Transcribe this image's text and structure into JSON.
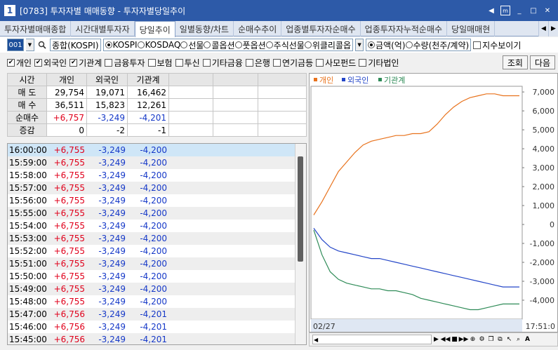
{
  "window": {
    "num": "1",
    "title": "[0783] 투자자별 매매동향 - 투자자별당일추이"
  },
  "tabs": [
    {
      "label": "투자자별매매종합",
      "active": false
    },
    {
      "label": "시간대별투자자",
      "active": false
    },
    {
      "label": "당일추이",
      "active": true
    },
    {
      "label": "일별동향/차트",
      "active": false
    },
    {
      "label": "순매수추이",
      "active": false
    },
    {
      "label": "업종별투자자순매수",
      "active": false
    },
    {
      "label": "업종투자자누적순매수",
      "active": false
    },
    {
      "label": "당일매매현",
      "active": false
    }
  ],
  "toolbar": {
    "code": "001",
    "market_name": "종합(KOSPI)",
    "markets": [
      "KOSPI",
      "KOSDAQ",
      "선물",
      "콜옵션",
      "풋옵션",
      "주식선물",
      "위클리콜옵"
    ],
    "market_selected": "KOSPI",
    "units": [
      "금액(억)",
      "수량(천주/계약)"
    ],
    "unit_selected": "금액(억)",
    "index_view_label": "지수보이기"
  },
  "filters": {
    "items": [
      {
        "label": "개인",
        "checked": true
      },
      {
        "label": "외국인",
        "checked": true
      },
      {
        "label": "기관계",
        "checked": true
      },
      {
        "label": "금융투자",
        "checked": false
      },
      {
        "label": "보험",
        "checked": false
      },
      {
        "label": "투신",
        "checked": false
      },
      {
        "label": "기타금융",
        "checked": false
      },
      {
        "label": "은행",
        "checked": false
      },
      {
        "label": "연기금등",
        "checked": false
      },
      {
        "label": "사모펀드",
        "checked": false
      },
      {
        "label": "기타법인",
        "checked": false
      }
    ],
    "query_label": "조회",
    "next_label": "다음"
  },
  "summary": {
    "headers": [
      "시간",
      "개인",
      "외국인",
      "기관계"
    ],
    "rows": [
      {
        "label": "매 도",
        "values": [
          "29,754",
          "19,071",
          "16,462"
        ]
      },
      {
        "label": "매 수",
        "values": [
          "36,511",
          "15,823",
          "12,261"
        ]
      },
      {
        "label": "순매수",
        "values": [
          "+6,757",
          "-3,249",
          "-4,201"
        ]
      },
      {
        "label": "증감",
        "values": [
          "0",
          "-2",
          "-1"
        ]
      }
    ]
  },
  "timeline": [
    {
      "time": "16:00:00",
      "ind": "+6,755",
      "for": "-3,249",
      "inst": "-4,200"
    },
    {
      "time": "15:59:00",
      "ind": "+6,755",
      "for": "-3,249",
      "inst": "-4,200"
    },
    {
      "time": "15:58:00",
      "ind": "+6,755",
      "for": "-3,249",
      "inst": "-4,200"
    },
    {
      "time": "15:57:00",
      "ind": "+6,755",
      "for": "-3,249",
      "inst": "-4,200"
    },
    {
      "time": "15:56:00",
      "ind": "+6,755",
      "for": "-3,249",
      "inst": "-4,200"
    },
    {
      "time": "15:55:00",
      "ind": "+6,755",
      "for": "-3,249",
      "inst": "-4,200"
    },
    {
      "time": "15:54:00",
      "ind": "+6,755",
      "for": "-3,249",
      "inst": "-4,200"
    },
    {
      "time": "15:53:00",
      "ind": "+6,755",
      "for": "-3,249",
      "inst": "-4,200"
    },
    {
      "time": "15:52:00",
      "ind": "+6,755",
      "for": "-3,249",
      "inst": "-4,200"
    },
    {
      "time": "15:51:00",
      "ind": "+6,755",
      "for": "-3,249",
      "inst": "-4,200"
    },
    {
      "time": "15:50:00",
      "ind": "+6,755",
      "for": "-3,249",
      "inst": "-4,200"
    },
    {
      "time": "15:49:00",
      "ind": "+6,755",
      "for": "-3,249",
      "inst": "-4,200"
    },
    {
      "time": "15:48:00",
      "ind": "+6,755",
      "for": "-3,249",
      "inst": "-4,200"
    },
    {
      "time": "15:47:00",
      "ind": "+6,756",
      "for": "-3,249",
      "inst": "-4,201"
    },
    {
      "time": "15:46:00",
      "ind": "+6,756",
      "for": "-3,249",
      "inst": "-4,201"
    },
    {
      "time": "15:45:00",
      "ind": "+6,756",
      "for": "-3,249",
      "inst": "-4,201"
    }
  ],
  "chart_data": {
    "type": "line",
    "legend": [
      "개인",
      "외국인",
      "기관계"
    ],
    "colors": {
      "개인": "#e8721c",
      "외국인": "#2446c8",
      "기관계": "#2e8b57"
    },
    "ylim": [
      -5000,
      7300
    ],
    "yticks": [
      7000,
      6000,
      5000,
      4000,
      3000,
      2000,
      1000,
      0,
      -1000,
      -2000,
      -3000,
      -4000
    ],
    "ytick_labels": [
      "7,000",
      "6,000",
      "5,000",
      "4,000",
      "3,000",
      "2,000",
      "1,000",
      "0",
      "-1,000",
      "-2,000",
      "-3,000",
      "-4,000"
    ],
    "x_label_left": "02/27",
    "x_label_right": "17:51:0",
    "series": [
      {
        "name": "개인",
        "values": [
          500,
          1200,
          2000,
          2800,
          3300,
          3800,
          4200,
          4400,
          4500,
          4600,
          4700,
          4700,
          4800,
          4800,
          4900,
          5300,
          5800,
          6200,
          6500,
          6700,
          6800,
          6900,
          6900,
          6800,
          6800,
          6800
        ]
      },
      {
        "name": "외국인",
        "values": [
          -200,
          -800,
          -1200,
          -1400,
          -1500,
          -1600,
          -1700,
          -1800,
          -1800,
          -1900,
          -2000,
          -2100,
          -2200,
          -2300,
          -2400,
          -2500,
          -2600,
          -2700,
          -2800,
          -2900,
          -3000,
          -3100,
          -3200,
          -3300,
          -3300,
          -3300
        ]
      },
      {
        "name": "기관계",
        "values": [
          -300,
          -1600,
          -2500,
          -2900,
          -3100,
          -3200,
          -3300,
          -3400,
          -3400,
          -3500,
          -3500,
          -3600,
          -3700,
          -3900,
          -4000,
          -4100,
          -4200,
          -4300,
          -4400,
          -4500,
          -4500,
          -4400,
          -4300,
          -4200,
          -4200,
          -4200
        ]
      }
    ]
  }
}
